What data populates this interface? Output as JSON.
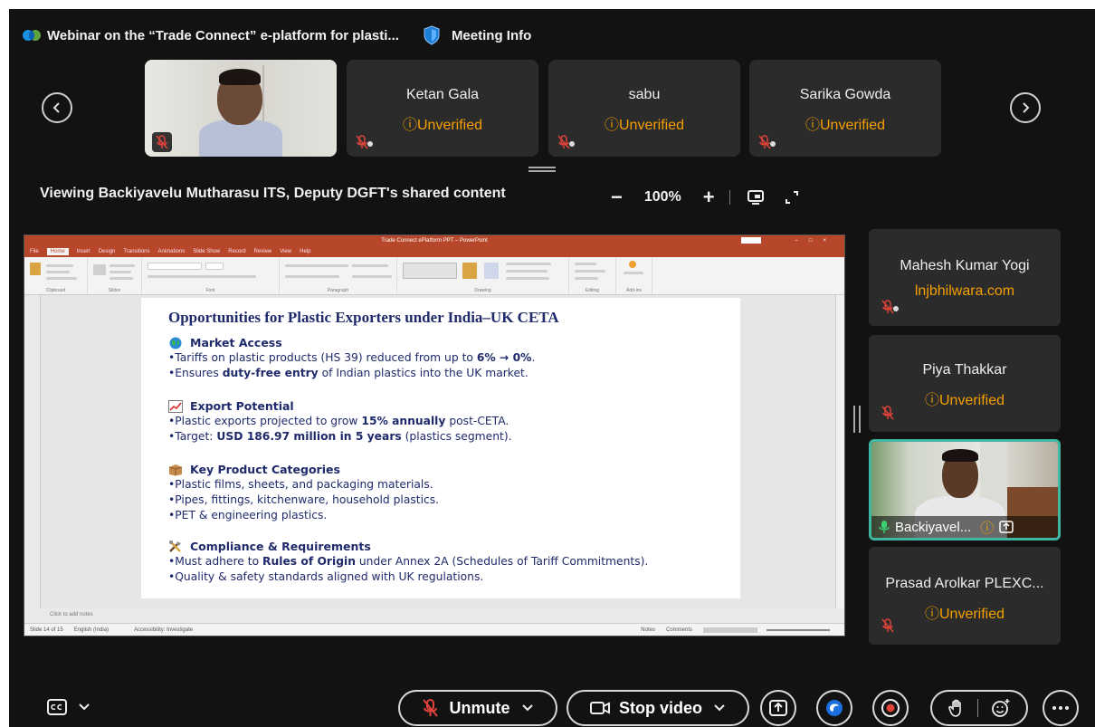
{
  "window": {
    "title": "Webinar on the “Trade Connect” e-platform for plasti...",
    "meeting_info_label": "Meeting Info"
  },
  "participants_top": [
    {
      "name": "Ketan Gala",
      "status": "Unverified"
    },
    {
      "name": "sabu",
      "status": "Unverified"
    },
    {
      "name": "Sarika Gowda",
      "status": "Unverified"
    }
  ],
  "share_header": {
    "viewing_text": "Viewing Backiyavelu Mutharasu ITS, Deputy DGFT's shared content",
    "zoom_minus": "−",
    "zoom_level": "100%",
    "zoom_plus": "+"
  },
  "powerpoint": {
    "window_title": "Trade Connect ePlatform PPT – PowerPoint",
    "tabs": [
      "File",
      "Home",
      "Insert",
      "Design",
      "Transitions",
      "Animations",
      "Slide Show",
      "Record",
      "Review",
      "View",
      "Help"
    ],
    "ribbon_groups": [
      "Clipboard",
      "Slides",
      "Font",
      "Paragraph",
      "Drawing",
      "Editing",
      "Add-ins"
    ],
    "notes_placeholder": "Click to add notes",
    "status_left": "Slide 14 of 15",
    "status_lang": "English (India)",
    "status_access": "Accessibility: Investigate",
    "status_notes": "Notes",
    "status_comments": "Comments"
  },
  "slide": {
    "title": "Opportunities for Plastic Exporters under India–UK CETA",
    "sections": [
      {
        "heading": "Market Access",
        "icon": "globe-icon",
        "bullets": [
          [
            "•Tariffs on plastic products (HS 39) reduced from up to ",
            "6% → 0%",
            "."
          ],
          [
            "•Ensures ",
            "duty-free entry",
            " of Indian plastics into the UK market."
          ]
        ]
      },
      {
        "heading": "Export Potential",
        "icon": "chart-up-icon",
        "bullets": [
          [
            "•Plastic exports projected to grow ",
            "15% annually",
            " post-CETA."
          ],
          [
            "•Target: ",
            "USD 186.97 million in 5 years",
            " (plastics segment)."
          ]
        ]
      },
      {
        "heading": "Key Product Categories",
        "icon": "box-icon",
        "bullets": [
          [
            "•Plastic films, sheets, and packaging materials.",
            "",
            ""
          ],
          [
            "•Pipes, fittings, kitchenware, household plastics.",
            "",
            ""
          ],
          [
            "•PET & engineering plastics.",
            "",
            ""
          ]
        ]
      },
      {
        "heading": "Compliance & Requirements",
        "icon": "tools-icon",
        "bullets": [
          [
            "•Must adhere to ",
            "Rules of Origin",
            " under Annex 2A (Schedules of Tariff Commitments)."
          ],
          [
            "•Quality & safety standards aligned with UK regulations.",
            "",
            ""
          ]
        ]
      }
    ]
  },
  "participants_side": [
    {
      "name": "Mahesh Kumar Yogi",
      "status": "lnjbhilwara.com"
    },
    {
      "name": "Piya Thakkar",
      "status": "Unverified"
    },
    {
      "name": "Backiyavel...",
      "status": ""
    },
    {
      "name": "Prasad Arolkar PLEXC...",
      "status": "Unverified"
    }
  ],
  "controls": {
    "unmute_label": "Unmute",
    "stop_video_label": "Stop video"
  },
  "colors": {
    "background": "#121212",
    "tile": "#2b2b2b",
    "unverified": "#f5a000",
    "mute_red": "#e0433a",
    "active_border": "#3fb7a3",
    "ppt_accent": "#b7472a"
  }
}
